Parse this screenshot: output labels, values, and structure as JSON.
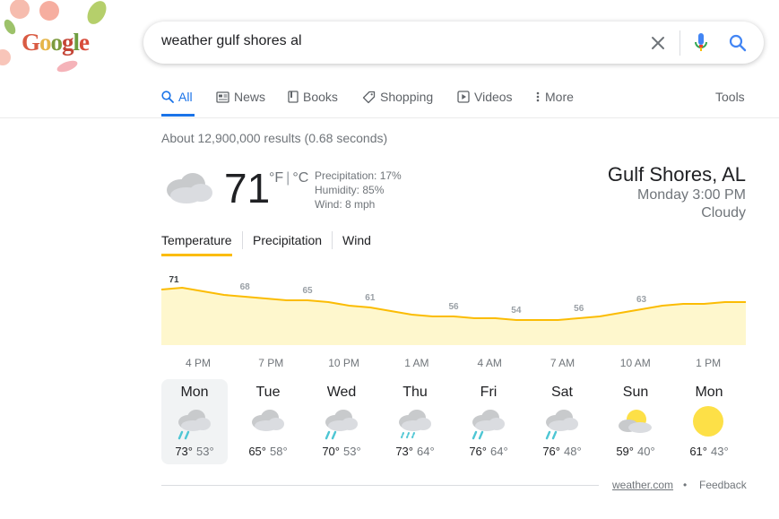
{
  "doodle": {
    "word": "Google"
  },
  "search": {
    "query": "weather gulf shores al"
  },
  "tabs": [
    {
      "label": "All",
      "icon": "search-icon"
    },
    {
      "label": "News",
      "icon": "news-icon"
    },
    {
      "label": "Books",
      "icon": "book-icon"
    },
    {
      "label": "Shopping",
      "icon": "tag-icon"
    },
    {
      "label": "Videos",
      "icon": "play-icon"
    },
    {
      "label": "More",
      "icon": "more-vert-icon"
    }
  ],
  "tools_label": "Tools",
  "result_stats": "About 12,900,000 results (0.68 seconds)",
  "weather": {
    "temperature": "71",
    "unit_f": "°F",
    "unit_c": "°C",
    "precipitation": "Precipitation: 17%",
    "humidity": "Humidity: 85%",
    "wind": "Wind: 8 mph",
    "location": "Gulf Shores, AL",
    "time": "Monday 3:00 PM",
    "condition": "Cloudy",
    "current_icon": "cloudy-icon"
  },
  "subtabs": [
    "Temperature",
    "Precipitation",
    "Wind"
  ],
  "chart_data": {
    "type": "area",
    "values": [
      71,
      72,
      70,
      68,
      67,
      66,
      65,
      65,
      64,
      62,
      61,
      59,
      57,
      56,
      56,
      55,
      55,
      54,
      54,
      54,
      55,
      56,
      58,
      60,
      62,
      63,
      63,
      64,
      64
    ],
    "labels": [
      {
        "index": 0,
        "text": "71"
      },
      {
        "index": 4,
        "text": "68"
      },
      {
        "index": 7,
        "text": "65"
      },
      {
        "index": 10,
        "text": "61"
      },
      {
        "index": 14,
        "text": "56"
      },
      {
        "index": 17,
        "text": "54"
      },
      {
        "index": 20,
        "text": "56"
      },
      {
        "index": 23,
        "text": "63"
      }
    ],
    "x_labels": [
      "4 PM",
      "7 PM",
      "10 PM",
      "1 AM",
      "4 AM",
      "7 AM",
      "10 AM",
      "1 PM"
    ],
    "line_color": "#fbbc04",
    "fill_color": "#fef7cd"
  },
  "forecast": [
    {
      "day": "Mon",
      "high": "73°",
      "low": "53°",
      "icon": "rain-cloud-icon"
    },
    {
      "day": "Tue",
      "high": "65°",
      "low": "58°",
      "icon": "cloudy-icon"
    },
    {
      "day": "Wed",
      "high": "70°",
      "low": "53°",
      "icon": "rain-cloud-icon"
    },
    {
      "day": "Thu",
      "high": "73°",
      "low": "64°",
      "icon": "drizzle-cloud-icon"
    },
    {
      "day": "Fri",
      "high": "76°",
      "low": "64°",
      "icon": "rain-cloud-icon"
    },
    {
      "day": "Sat",
      "high": "76°",
      "low": "48°",
      "icon": "rain-cloud-icon"
    },
    {
      "day": "Sun",
      "high": "59°",
      "low": "40°",
      "icon": "partly-cloudy-icon"
    },
    {
      "day": "Mon",
      "high": "61°",
      "low": "43°",
      "icon": "sunny-icon"
    }
  ],
  "footer": {
    "source": "weather.com",
    "separator": "•",
    "feedback": "Feedback"
  },
  "colors": {
    "accent": "#1a73e8",
    "chart_line": "#fbbc04",
    "chart_fill": "#fef7cd",
    "sun": "#fde047"
  }
}
